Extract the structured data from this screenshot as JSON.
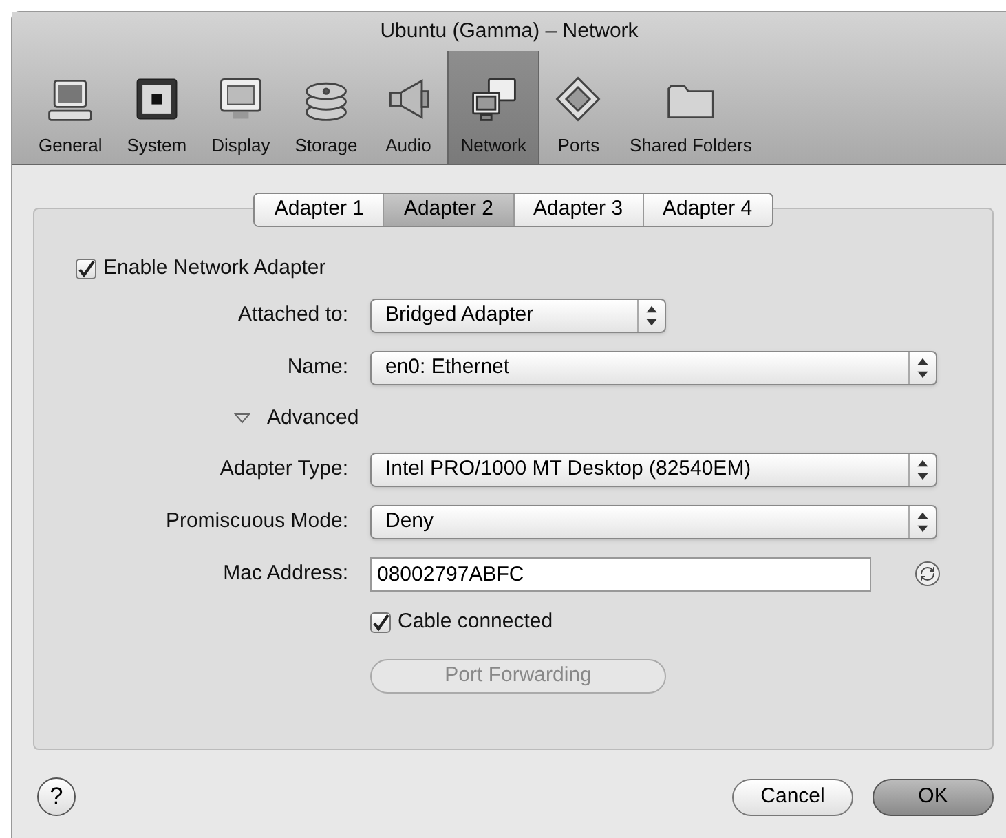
{
  "window": {
    "title": "Ubuntu (Gamma) – Network"
  },
  "toolbar": [
    {
      "label": "General",
      "kind": "general",
      "selected": false
    },
    {
      "label": "System",
      "kind": "system",
      "selected": false
    },
    {
      "label": "Display",
      "kind": "display",
      "selected": false
    },
    {
      "label": "Storage",
      "kind": "storage",
      "selected": false
    },
    {
      "label": "Audio",
      "kind": "audio",
      "selected": false
    },
    {
      "label": "Network",
      "kind": "network",
      "selected": true
    },
    {
      "label": "Ports",
      "kind": "ports",
      "selected": false
    },
    {
      "label": "Shared Folders",
      "kind": "folders",
      "selected": false
    }
  ],
  "tabs": [
    {
      "label": "Adapter 1",
      "selected": false
    },
    {
      "label": "Adapter 2",
      "selected": true
    },
    {
      "label": "Adapter 3",
      "selected": false
    },
    {
      "label": "Adapter 4",
      "selected": false
    }
  ],
  "enable_adapter": {
    "label": "Enable Network Adapter",
    "checked": true
  },
  "attached_to": {
    "label": "Attached to:",
    "value": "Bridged Adapter"
  },
  "name": {
    "label": "Name:",
    "value": "en0: Ethernet"
  },
  "advanced": {
    "label": "Advanced",
    "expanded": true
  },
  "adapter_type": {
    "label": "Adapter Type:",
    "value": "Intel PRO/1000 MT Desktop (82540EM)"
  },
  "promiscuous_mode": {
    "label": "Promiscuous Mode:",
    "value": "Deny"
  },
  "mac_address": {
    "label": "Mac Address:",
    "value": "08002797ABFC"
  },
  "cable_connected": {
    "label": "Cable connected",
    "checked": true
  },
  "port_forwarding": {
    "label": "Port Forwarding",
    "disabled": true
  },
  "footer": {
    "help": "?",
    "buttons": [
      {
        "label": "Cancel",
        "default": false
      },
      {
        "label": "OK",
        "default": true
      }
    ]
  }
}
